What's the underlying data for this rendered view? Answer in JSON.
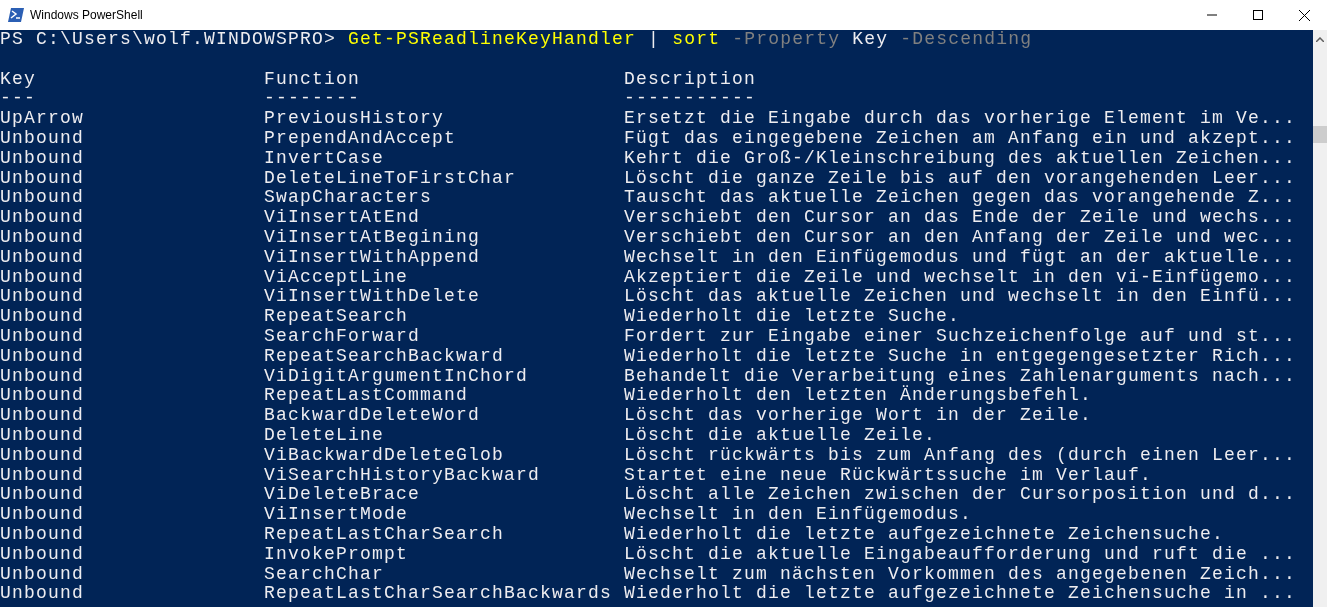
{
  "window": {
    "title": "Windows PowerShell"
  },
  "command_line": [
    {
      "kind": "prompt",
      "text": "PS C:\\Users\\wolf.WINDOWSPRO>"
    },
    {
      "kind": "command",
      "text": "Get-PSReadlineKeyHandler"
    },
    {
      "kind": "operator",
      "text": "|"
    },
    {
      "kind": "command",
      "text": "sort"
    },
    {
      "kind": "parameter",
      "text": "-Property"
    },
    {
      "kind": "argument",
      "text": "Key"
    },
    {
      "kind": "parameter",
      "text": "-Descending"
    }
  ],
  "table": {
    "columns": [
      {
        "heading": "Key",
        "underline": "---"
      },
      {
        "heading": "Function",
        "underline": "--------"
      },
      {
        "heading": "Description",
        "underline": "-----------"
      }
    ],
    "rows": [
      [
        "UpArrow",
        "PreviousHistory",
        "Ersetzt die Eingabe durch das vorherige Element im Ve..."
      ],
      [
        "Unbound",
        "PrependAndAccept",
        "Fügt das eingegebene Zeichen am Anfang ein und akzept..."
      ],
      [
        "Unbound",
        "InvertCase",
        "Kehrt die Groß-/Kleinschreibung des aktuellen Zeichen..."
      ],
      [
        "Unbound",
        "DeleteLineToFirstChar",
        "Löscht die ganze Zeile bis auf den vorangehenden Leer..."
      ],
      [
        "Unbound",
        "SwapCharacters",
        "Tauscht das aktuelle Zeichen gegen das vorangehende Z..."
      ],
      [
        "Unbound",
        "ViInsertAtEnd",
        "Verschiebt den Cursor an das Ende der Zeile und wechs..."
      ],
      [
        "Unbound",
        "ViInsertAtBegining",
        "Verschiebt den Cursor an den Anfang der Zeile und wec..."
      ],
      [
        "Unbound",
        "ViInsertWithAppend",
        "Wechselt in den Einfügemodus und fügt an der aktuelle..."
      ],
      [
        "Unbound",
        "ViAcceptLine",
        "Akzeptiert die Zeile und wechselt in den vi-Einfügemo..."
      ],
      [
        "Unbound",
        "ViInsertWithDelete",
        "Löscht das aktuelle Zeichen und wechselt in den Einfü..."
      ],
      [
        "Unbound",
        "RepeatSearch",
        "Wiederholt die letzte Suche."
      ],
      [
        "Unbound",
        "SearchForward",
        "Fordert zur Eingabe einer Suchzeichenfolge auf und st..."
      ],
      [
        "Unbound",
        "RepeatSearchBackward",
        "Wiederholt die letzte Suche in entgegengesetzter Rich..."
      ],
      [
        "Unbound",
        "ViDigitArgumentInChord",
        "Behandelt die Verarbeitung eines Zahlenarguments nach..."
      ],
      [
        "Unbound",
        "RepeatLastCommand",
        "Wiederholt den letzten Änderungsbefehl."
      ],
      [
        "Unbound",
        "BackwardDeleteWord",
        "Löscht das vorherige Wort in der Zeile."
      ],
      [
        "Unbound",
        "DeleteLine",
        "Löscht die aktuelle Zeile."
      ],
      [
        "Unbound",
        "ViBackwardDeleteGlob",
        "Löscht rückwärts bis zum Anfang des (durch einen Leer..."
      ],
      [
        "Unbound",
        "ViSearchHistoryBackward",
        "Startet eine neue Rückwärtssuche im Verlauf."
      ],
      [
        "Unbound",
        "ViDeleteBrace",
        "Löscht alle Zeichen zwischen der Cursorposition und d..."
      ],
      [
        "Unbound",
        "ViInsertMode",
        "Wechselt in den Einfügemodus."
      ],
      [
        "Unbound",
        "RepeatLastCharSearch",
        "Wiederholt die letzte aufgezeichnete Zeichensuche."
      ],
      [
        "Unbound",
        "InvokePrompt",
        "Löscht die aktuelle Eingabeaufforderung und ruft die ..."
      ],
      [
        "Unbound",
        "SearchChar",
        "Wechselt zum nächsten Vorkommen des angegebenen Zeich..."
      ],
      [
        "Unbound",
        "RepeatLastCharSearchBackwards",
        "Wiederholt die letzte aufgezeichnete Zeichensuche in ..."
      ]
    ]
  }
}
